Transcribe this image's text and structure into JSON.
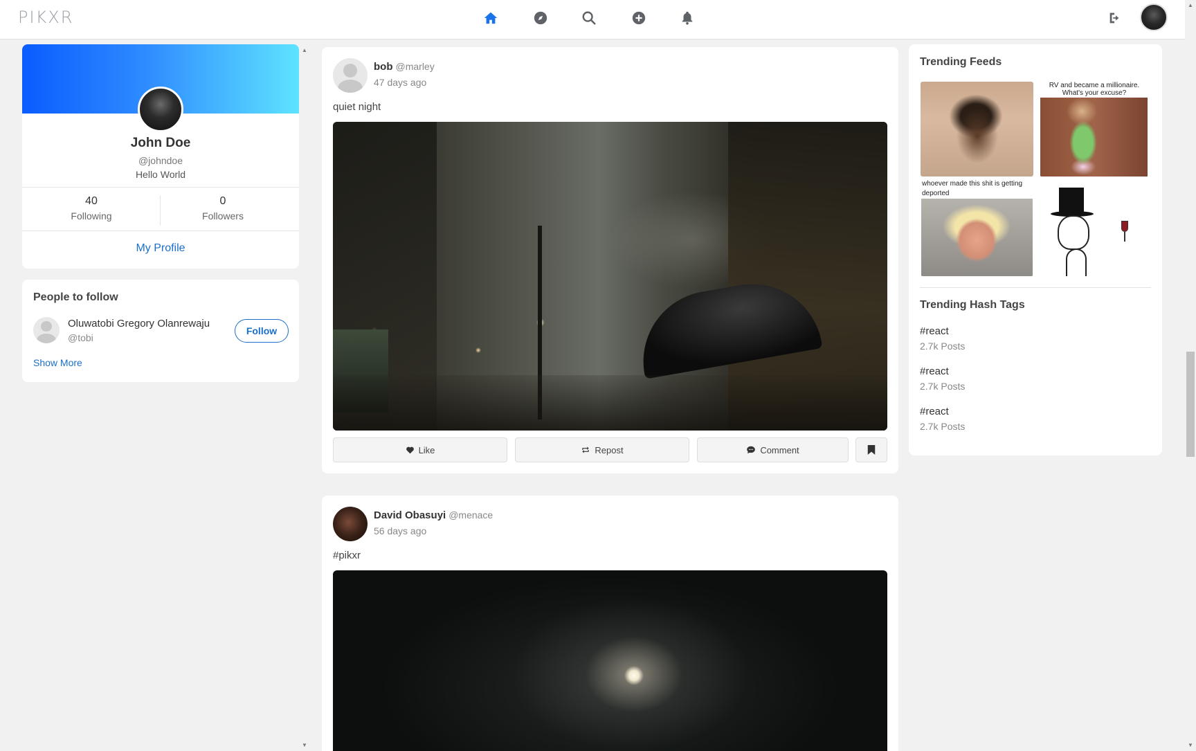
{
  "app": {
    "logo": "PIKXR"
  },
  "nav": {
    "items": [
      {
        "name": "home",
        "icon": "home-icon",
        "active": true
      },
      {
        "name": "explore",
        "icon": "compass-icon"
      },
      {
        "name": "search",
        "icon": "search-icon"
      },
      {
        "name": "create",
        "icon": "plus-circle-icon"
      },
      {
        "name": "notifications",
        "icon": "bell-icon"
      }
    ],
    "logout_icon": "logout-icon",
    "accent_color": "#1a73e8"
  },
  "profile": {
    "name": "John Doe",
    "handle": "@johndoe",
    "bio": "Hello World",
    "following_count": "40",
    "following_label": "Following",
    "followers_count": "0",
    "followers_label": "Followers",
    "my_profile_label": "My Profile"
  },
  "people_to_follow": {
    "title": "People to follow",
    "people": [
      {
        "name": "Oluwatobi Gregory Olanrewaju",
        "handle": "@tobi",
        "button_label": "Follow"
      }
    ],
    "show_more_label": "Show More"
  },
  "feed": {
    "posts": [
      {
        "author": "bob",
        "handle": "@marley",
        "time": "47 days ago",
        "text": "quiet night",
        "actions": {
          "like": "Like",
          "repost": "Repost",
          "comment": "Comment"
        }
      },
      {
        "author": "David Obasuyi",
        "handle": "@menace",
        "time": "56 days ago",
        "text": "#pikxr"
      }
    ]
  },
  "trending": {
    "feeds_title": "Trending Feeds",
    "memes": [
      {
        "caption": ""
      },
      {
        "caption": "RV and became a millionaire. What's your excuse?"
      },
      {
        "caption": "whoever made this shit is getting deported"
      },
      {
        "caption": ""
      }
    ],
    "hashtags_title": "Trending Hash Tags",
    "hashtags": [
      {
        "tag": "#react",
        "count": "2.7k Posts"
      },
      {
        "tag": "#react",
        "count": "2.7k Posts"
      },
      {
        "tag": "#react",
        "count": "2.7k Posts"
      }
    ]
  }
}
